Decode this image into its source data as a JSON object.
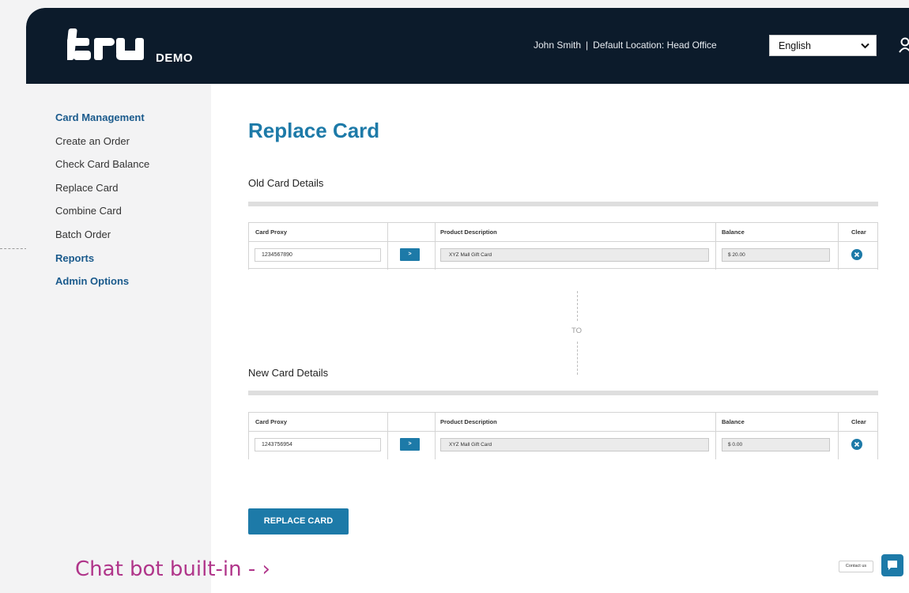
{
  "header": {
    "logo_text": "tru",
    "logo_suffix": "DEMO",
    "user_name": "John Smith",
    "separator": "|",
    "location_label": "Default Location:",
    "location_value": "Head Office",
    "language": "English"
  },
  "sidebar": {
    "items": [
      {
        "label": "Card Management",
        "type": "heading"
      },
      {
        "label": "Create an Order"
      },
      {
        "label": "Check Card Balance"
      },
      {
        "label": "Replace Card"
      },
      {
        "label": "Combine Card"
      },
      {
        "label": "Batch Order"
      },
      {
        "label": "Reports",
        "type": "heading"
      },
      {
        "label": "Admin Options",
        "type": "heading"
      }
    ]
  },
  "main": {
    "title": "Replace Card",
    "old_section": {
      "label": "Old Card Details",
      "columns": [
        "Card Proxy",
        "Product Description",
        "Balance",
        "Clear"
      ],
      "card_proxy": "1234567890",
      "go_label": ">",
      "product_description": "XYZ Mall Gift Card",
      "balance": "$ 20.00"
    },
    "to_label": "TO",
    "new_section": {
      "label": "New Card Details",
      "columns": [
        "Card Proxy",
        "Product Description",
        "Balance",
        "Clear"
      ],
      "card_proxy": "1243756954",
      "go_label": ">",
      "product_description": "XYZ Mall Gift Card",
      "balance": "$ 0.00"
    },
    "replace_button": "REPLACE CARD"
  },
  "overlay": {
    "chatbot_label": "Chat bot built-in - ›",
    "contact_label": "Contact us"
  },
  "colors": {
    "header_bg": "#0c1b2b",
    "accent": "#1d7aa8",
    "sidebar_heading": "#1a5a8c",
    "annotation": "#b0358a"
  }
}
